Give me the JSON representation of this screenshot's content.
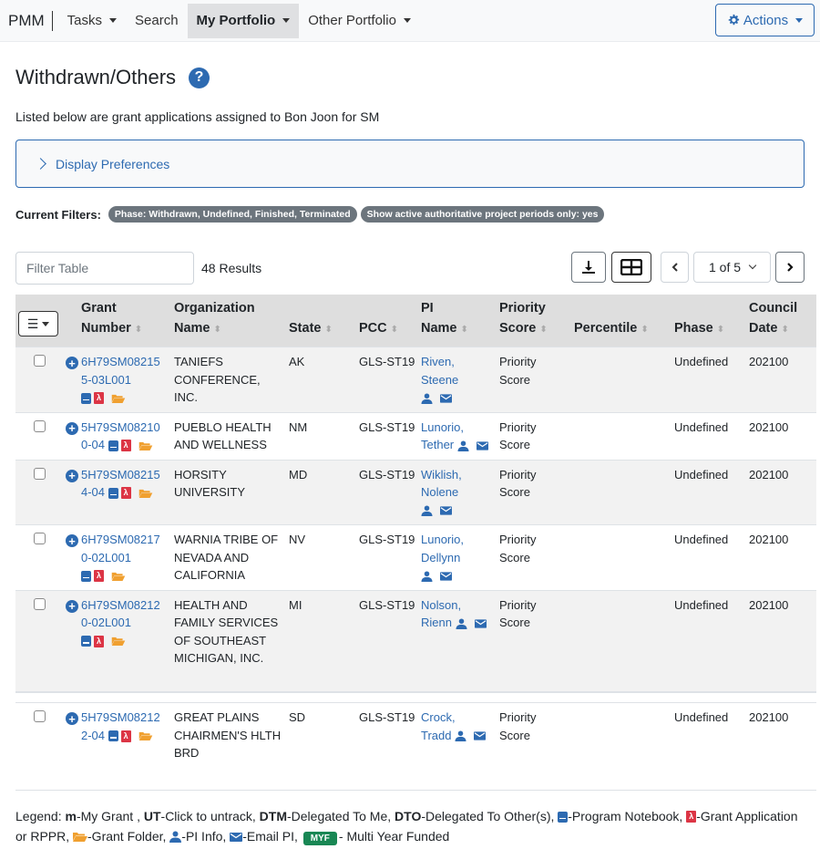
{
  "nav": {
    "brand": "PMM",
    "items": [
      {
        "label": "Tasks",
        "dropdown": true,
        "active": false
      },
      {
        "label": "Search",
        "dropdown": false,
        "active": false
      },
      {
        "label": "My Portfolio",
        "dropdown": true,
        "active": true
      },
      {
        "label": "Other Portfolio",
        "dropdown": true,
        "active": false
      }
    ],
    "actions_label": "Actions",
    "actions_icon": "gear-icon"
  },
  "page": {
    "title": "Withdrawn/Others",
    "help_icon": "question-circle-icon",
    "subtitle": "Listed below are grant applications assigned to Bon Joon for SM",
    "display_preferences_label": "Display Preferences",
    "filters_label": "Current Filters:",
    "filters": [
      "Phase: Withdrawn, Undefined, Finished, Terminated",
      "Show active authoritative project periods only: yes"
    ]
  },
  "toolbar": {
    "filter_placeholder": "Filter Table",
    "filter_value": "",
    "results": "48 Results",
    "download_icon": "download-icon",
    "grid_icon": "table-columns-icon",
    "pager": "1 of 5"
  },
  "table": {
    "headers": [
      {
        "line1": "Grant",
        "line2": "Number"
      },
      {
        "line1": "Organization",
        "line2": "Name"
      },
      {
        "line1": "",
        "line2": "State"
      },
      {
        "line1": "",
        "line2": "PCC"
      },
      {
        "line1": "PI",
        "line2": "Name"
      },
      {
        "line1": "Priority",
        "line2": "Score"
      },
      {
        "line1": "",
        "line2": "Percentile"
      },
      {
        "line1": "",
        "line2": "Phase"
      },
      {
        "line1": "Council",
        "line2": "Date"
      }
    ],
    "rows": [
      {
        "grant_line1": "6H79SM08215",
        "grant_line2": "5-03L001",
        "org": "TANIEFS CONFERENCE, INC.",
        "state": "AK",
        "pcc": "GLS-ST19",
        "pi_last": "Riven,",
        "pi_first": "Steene",
        "priority": "Priority Score",
        "percentile": "",
        "phase": "Undefined",
        "council": "202100"
      },
      {
        "grant_line1": "5H79SM08210",
        "grant_line2": "0-04",
        "org": "PUEBLO HEALTH AND WELLNESS",
        "state": "NM",
        "pcc": "GLS-ST19",
        "pi_last": "Lunorio,",
        "pi_first": "Tether",
        "priority": "Priority Score",
        "percentile": "",
        "phase": "Undefined",
        "council": "202100"
      },
      {
        "grant_line1": "5H79SM08215",
        "grant_line2": "4-04",
        "org": "HORSITY UNIVERSITY",
        "state": "MD",
        "pcc": "GLS-ST19",
        "pi_last": "Wiklish,",
        "pi_first": "Nolene",
        "priority": "Priority Score",
        "percentile": "",
        "phase": "Undefined",
        "council": "202100"
      },
      {
        "grant_line1": "6H79SM08217",
        "grant_line2": "0-02L001",
        "org": "WARNIA TRIBE OF NEVADA AND CALIFORNIA",
        "state": "NV",
        "pcc": "GLS-ST19",
        "pi_last": "Lunorio,",
        "pi_first": "Dellynn",
        "priority": "Priority Score",
        "percentile": "",
        "phase": "Undefined",
        "council": "202100"
      },
      {
        "grant_line1": "6H79SM08212",
        "grant_line2": "0-02L001",
        "org": "HEALTH AND FAMILY SERVICES OF SOUTHEAST MICHIGAN, INC.",
        "state": "MI",
        "pcc": "GLS-ST19",
        "pi_last": "Nolson,",
        "pi_first": "Rienn",
        "priority": "Priority Score",
        "percentile": "",
        "phase": "Undefined",
        "council": "202100"
      },
      {
        "grant_line1": "5H79SM08212",
        "grant_line2": "2-04",
        "org": "GREAT PLAINS CHAIRMEN'S HLTH BRD",
        "state": "SD",
        "pcc": "GLS-ST19",
        "pi_last": "Crock,",
        "pi_first": "Tradd",
        "priority": "Priority Score",
        "percentile": "",
        "phase": "Undefined",
        "council": "202100"
      }
    ]
  },
  "legend": {
    "prefix": "Legend:",
    "m_key": "m",
    "m_text": "-My Grant ,",
    "ut_key": "UT",
    "ut_text": "-Click to untrack,",
    "dtm_key": "DTM",
    "dtm_text": "-Delegated To Me,",
    "dto_key": "DTO",
    "dto_text": "-Delegated To Other(s),",
    "notebook_text": "-Program Notebook,",
    "pdf_text": "-Grant Application or RPPR,",
    "folder_text": "-Grant Folder,",
    "pi_text": "-PI Info,",
    "email_text": "-Email PI,",
    "myf_badge": "MYF",
    "myf_text": "- Multi Year Funded"
  },
  "colors": {
    "primary": "#2d6ab1",
    "pdf_red": "#dc3545",
    "folder_orange": "#f0a030",
    "myf_green": "#198754",
    "pill_gray": "#6c757d"
  }
}
